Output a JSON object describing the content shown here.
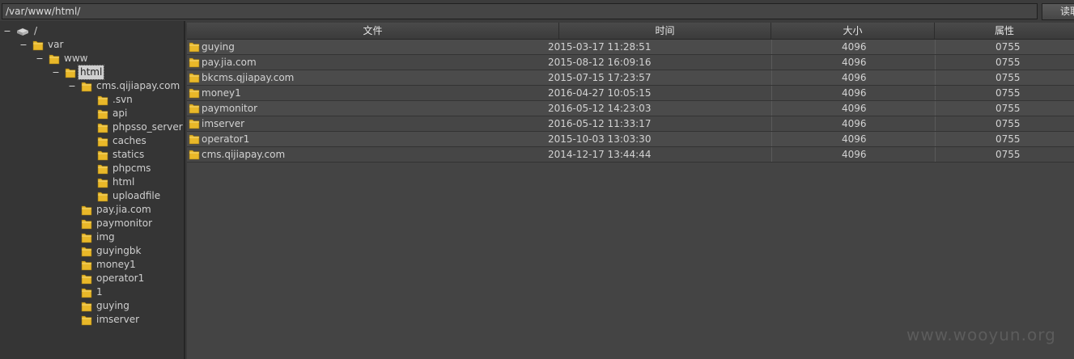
{
  "path_bar": {
    "value": "/var/www/html/",
    "read_button": "读取"
  },
  "tree": [
    {
      "label": "/",
      "toggle": "−",
      "icon": "drive-icon",
      "depth": 0
    },
    {
      "label": "var",
      "toggle": "−",
      "icon": "folder-icon",
      "depth": 1
    },
    {
      "label": "www",
      "toggle": "−",
      "icon": "folder-icon",
      "depth": 2
    },
    {
      "label": "html",
      "toggle": "−",
      "icon": "folder-icon",
      "depth": 3,
      "selected": true
    },
    {
      "label": "cms.qijiapay.com",
      "toggle": "−",
      "icon": "folder-icon",
      "depth": 4
    },
    {
      "label": ".svn",
      "toggle": "",
      "icon": "folder-icon",
      "depth": 5
    },
    {
      "label": "api",
      "toggle": "",
      "icon": "folder-icon",
      "depth": 5
    },
    {
      "label": "phpsso_server",
      "toggle": "",
      "icon": "folder-icon",
      "depth": 5
    },
    {
      "label": "caches",
      "toggle": "",
      "icon": "folder-icon",
      "depth": 5
    },
    {
      "label": "statics",
      "toggle": "",
      "icon": "folder-icon",
      "depth": 5
    },
    {
      "label": "phpcms",
      "toggle": "",
      "icon": "folder-icon",
      "depth": 5
    },
    {
      "label": "html",
      "toggle": "",
      "icon": "folder-icon",
      "depth": 5
    },
    {
      "label": "uploadfile",
      "toggle": "",
      "icon": "folder-icon",
      "depth": 5
    },
    {
      "label": "pay.jia.com",
      "toggle": "",
      "icon": "folder-icon",
      "depth": 4
    },
    {
      "label": "paymonitor",
      "toggle": "",
      "icon": "folder-icon",
      "depth": 4
    },
    {
      "label": "img",
      "toggle": "",
      "icon": "folder-icon",
      "depth": 4
    },
    {
      "label": "guyingbk",
      "toggle": "",
      "icon": "folder-icon",
      "depth": 4
    },
    {
      "label": "money1",
      "toggle": "",
      "icon": "folder-icon",
      "depth": 4
    },
    {
      "label": "operator1",
      "toggle": "",
      "icon": "folder-icon",
      "depth": 4
    },
    {
      "label": "1",
      "toggle": "",
      "icon": "folder-icon",
      "depth": 4
    },
    {
      "label": "guying",
      "toggle": "",
      "icon": "folder-icon",
      "depth": 4
    },
    {
      "label": "imserver",
      "toggle": "",
      "icon": "folder-icon",
      "depth": 4
    }
  ],
  "file_list": {
    "columns": [
      "文件",
      "时间",
      "大小",
      "属性"
    ],
    "rows": [
      {
        "name": "guying",
        "time": "2015-03-17 11:28:51",
        "size": "4096",
        "perm": "0755"
      },
      {
        "name": "pay.jia.com",
        "time": "2015-08-12 16:09:16",
        "size": "4096",
        "perm": "0755"
      },
      {
        "name": "bkcms.qjiapay.com",
        "time": "2015-07-15 17:23:57",
        "size": "4096",
        "perm": "0755"
      },
      {
        "name": "money1",
        "time": "2016-04-27 10:05:15",
        "size": "4096",
        "perm": "0755"
      },
      {
        "name": "paymonitor",
        "time": "2016-05-12 14:23:03",
        "size": "4096",
        "perm": "0755"
      },
      {
        "name": "imserver",
        "time": "2016-05-12 11:33:17",
        "size": "4096",
        "perm": "0755"
      },
      {
        "name": "operator1",
        "time": "2015-10-03 13:03:30",
        "size": "4096",
        "perm": "0755"
      },
      {
        "name": "cms.qijiapay.com",
        "time": "2014-12-17 13:44:44",
        "size": "4096",
        "perm": "0755"
      }
    ]
  },
  "watermark": "www.wooyun.org",
  "colors": {
    "folder": "#e9b829",
    "selected_bg": "#cfcfcf",
    "panel_bg": "#353535"
  }
}
